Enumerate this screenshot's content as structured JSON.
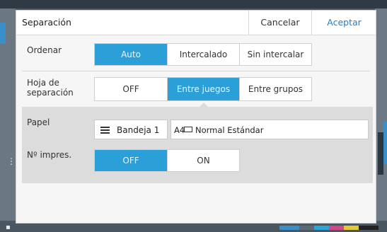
{
  "dialog": {
    "title": "Separación",
    "cancel_label": "Cancelar",
    "ok_label": "Aceptar"
  },
  "sort": {
    "label": "Ordenar",
    "options": [
      "Auto",
      "Intercalado",
      "Sin intercalar"
    ],
    "selected": "Auto"
  },
  "separator_sheet": {
    "label_line1": "Hoja de",
    "label_line2": "separación",
    "options": [
      "OFF",
      "Entre juegos",
      "Entre grupos"
    ],
    "selected": "Entre juegos"
  },
  "paper": {
    "label": "Papel",
    "tray_label": "Bandeja 1",
    "tray_icon": "tray-icon",
    "size": "A4",
    "orientation_icon": "landscape-paper-icon",
    "type": "Normal Estándar"
  },
  "print_number": {
    "label": "Nº impres.",
    "options": [
      "OFF",
      "ON"
    ],
    "selected": "OFF"
  },
  "colors": {
    "accent": "#2a9fd8",
    "ok_text": "#1f7fc4"
  }
}
